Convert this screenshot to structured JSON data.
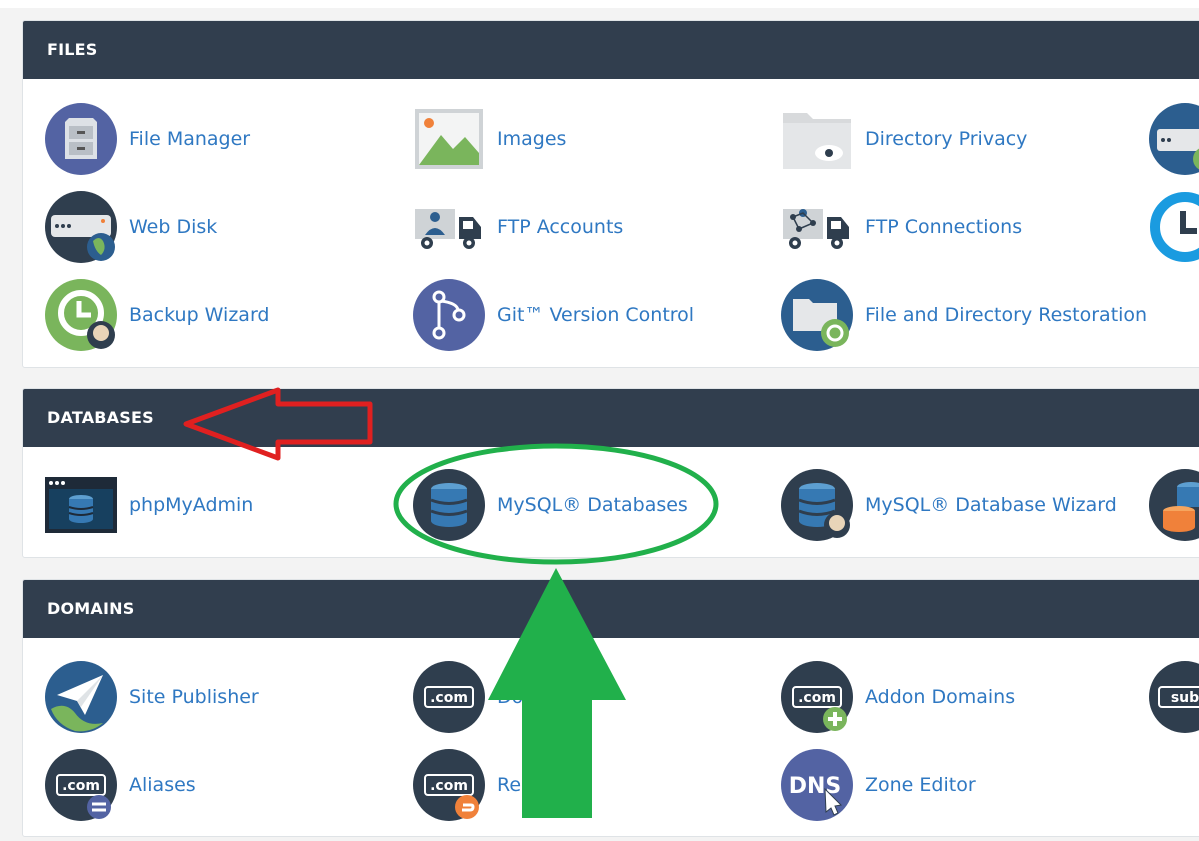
{
  "colors": {
    "header_bg": "#313e4e",
    "link": "#2f78c2",
    "icon_navy": "#2f3e4e",
    "icon_purple": "#5363a3",
    "icon_blue": "#2c5e8f",
    "icon_green": "#7ab55c",
    "icon_orange": "#f0813a",
    "annotation_red": "#e02020",
    "annotation_green": "#21b04b"
  },
  "sections": {
    "files": {
      "title": "FILES",
      "items": [
        {
          "label": "File Manager",
          "icon": "file-cabinet-icon"
        },
        {
          "label": "Images",
          "icon": "images-icon"
        },
        {
          "label": "Directory Privacy",
          "icon": "folder-eye-icon"
        },
        {
          "label": "",
          "icon": "disk-usage-icon"
        },
        {
          "label": "Web Disk",
          "icon": "web-disk-icon"
        },
        {
          "label": "FTP Accounts",
          "icon": "ftp-accounts-icon"
        },
        {
          "label": "FTP Connections",
          "icon": "ftp-connections-icon"
        },
        {
          "label": "",
          "icon": "backup-icon"
        },
        {
          "label": "Backup Wizard",
          "icon": "backup-wizard-icon"
        },
        {
          "label": "Git™ Version Control",
          "icon": "git-icon"
        },
        {
          "label": "File and Directory Restoration",
          "icon": "folder-restore-icon"
        }
      ]
    },
    "databases": {
      "title": "DATABASES",
      "items": [
        {
          "label": "phpMyAdmin",
          "icon": "phpmyadmin-icon"
        },
        {
          "label": "MySQL® Databases",
          "icon": "mysql-databases-icon"
        },
        {
          "label": "MySQL® Database Wizard",
          "icon": "mysql-wizard-icon"
        },
        {
          "label": "",
          "icon": "remote-mysql-icon"
        }
      ]
    },
    "domains": {
      "title": "DOMAINS",
      "items": [
        {
          "label": "Site Publisher",
          "icon": "paper-plane-globe-icon"
        },
        {
          "label": "Do",
          "icon": "dotcom-icon"
        },
        {
          "label": "Addon Domains",
          "icon": "dotcom-plus-icon"
        },
        {
          "label": "",
          "icon": "subdomain-icon"
        },
        {
          "label": "Aliases",
          "icon": "dotcom-equals-icon"
        },
        {
          "label": "Re",
          "icon": "dotcom-redirect-icon"
        },
        {
          "label": "Zone Editor",
          "icon": "dns-icon"
        }
      ]
    }
  }
}
